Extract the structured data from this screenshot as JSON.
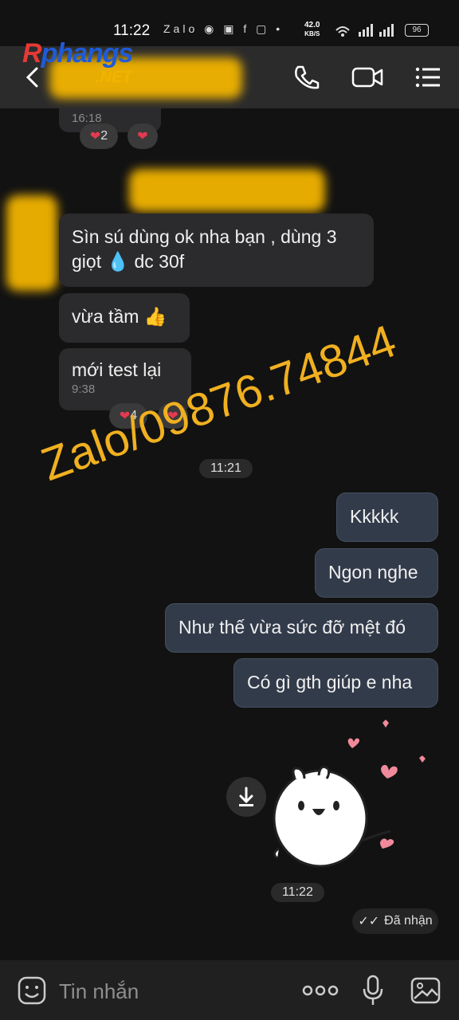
{
  "status": {
    "time": "11:22",
    "net_speed": "42.0",
    "net_unit": "KB/S",
    "battery": "96",
    "app_icons": "Zalo ◉ ▣ f ▢ •"
  },
  "header": {
    "back_label": "‹",
    "logo_r": "R",
    "logo_main": "phangs",
    "logo_net": ".NET"
  },
  "messages": {
    "top_time": "16:18",
    "top_react_count": "2",
    "msg1": "Sìn sú dùng ok nha bạn , dùng 3 giọt 💧 dc 30f",
    "msg2": "vừa tầm 👍",
    "msg3": "mới test lại",
    "msg3_time": "9:38",
    "msg3_react_count": "4",
    "divider_time": "11:21",
    "out1": "Kkkkk",
    "out2": "Ngon nghe",
    "out3": "Như thế vừa sức đỡ mệt đó",
    "out4": "Có gì gth giúp e nha",
    "sticker_time": "11:22",
    "status": "Đã nhận"
  },
  "watermark": "Zalo/09876.74844",
  "composer": {
    "placeholder": "Tin nhắn"
  },
  "colors": {
    "accent": "#f2b400",
    "heart": "#e53950",
    "outgoing_bg": "#323b4a"
  }
}
